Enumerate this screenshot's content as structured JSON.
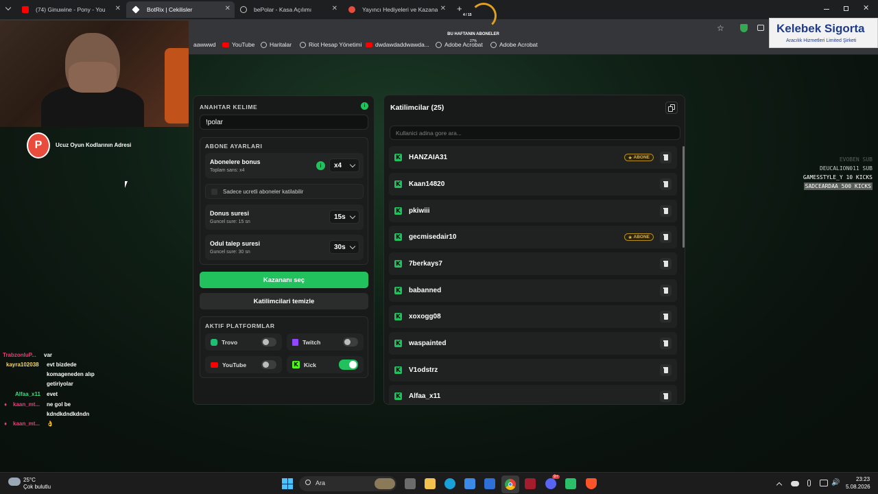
{
  "browser": {
    "tabs": [
      {
        "label": "(74) Ginuwine - Pony - You",
        "favicon_color": "#ff0000"
      },
      {
        "label": "BotRix | Cekilisler",
        "favicon_color": "#ffffff"
      },
      {
        "label": "bePolar - Kasa Açılımı",
        "favicon_color": "#e8eaed"
      },
      {
        "label": "Yayıncı Hediyeleri ve Kazananlar",
        "favicon_color": "#e84c3d"
      }
    ],
    "new_tab": "+",
    "bookmarks": [
      "aawwwd",
      "YouTube",
      "Haritalar",
      "Riot Hesap Yönetimi",
      "dwdawdaddwawda...",
      "Adobe Acrobat",
      "Adobe Acrobat"
    ]
  },
  "overlay": {
    "sub_goal_title": "BU HAFTANIN ABONELER",
    "sub_goal_percent": "27%",
    "sub_goal_count": "4 / 15",
    "sponsor_name": "Kelebek Sigorta",
    "sponsor_sub": "Aracılık Hizmetleri Limited Şirketi",
    "promo_text": "Ucuz Oyun Kodlarının Adresi",
    "events": [
      "EVOBEN SUB",
      "DEUCALION011 SUB",
      "GAMESSTYLE_Y 10 KICKS",
      "SADCEARDAA 500 KICKS"
    ]
  },
  "settings": {
    "keyword_label": "ANAHTAR KELIME",
    "keyword_value": "!polar",
    "sub_section_label": "ABONE AYARLARI",
    "bonus_title": "Abonelere bonus",
    "bonus_sub": "Toplam sans: x4",
    "bonus_value": "x4",
    "only_paid_label": "Sadece ucretli aboneler katilabilir",
    "duration_title": "Donus suresi",
    "duration_sub": "Guncel sure: 15 sn",
    "duration_value": "15s",
    "claim_title": "Odul talep suresi",
    "claim_sub": "Guncel sure: 30 sn",
    "claim_value": "30s",
    "pick_winner": "Kazananı seç",
    "clear_participants": "Katilimcilari temizle",
    "platforms_label": "AKTIF PLATFORMLAR",
    "platforms": [
      {
        "name": "Trovo",
        "enabled": false,
        "color": "#1dbf73"
      },
      {
        "name": "Twitch",
        "enabled": false,
        "color": "#9146ff"
      },
      {
        "name": "YouTube",
        "enabled": false,
        "color": "#ff0000"
      },
      {
        "name": "Kick",
        "enabled": true,
        "color": "#53fc18"
      }
    ]
  },
  "participants": {
    "title": "Katilimcilar (25)",
    "search_placeholder": "Kullanici adina gore ara...",
    "abone_badge": "ABONE",
    "list": [
      {
        "name": "HANZAIA31",
        "sub": true
      },
      {
        "name": "Kaan14820",
        "sub": false
      },
      {
        "name": "pkiwiii",
        "sub": false
      },
      {
        "name": "gecmisedair10",
        "sub": true
      },
      {
        "name": "7berkays7",
        "sub": false
      },
      {
        "name": "babanned",
        "sub": false
      },
      {
        "name": "xoxogg08",
        "sub": false
      },
      {
        "name": "waspainted",
        "sub": false
      },
      {
        "name": "V1odstrz",
        "sub": false
      },
      {
        "name": "Alfaa_x11",
        "sub": false
      }
    ]
  },
  "chat": [
    {
      "user": "TrabzonluP...",
      "msg": "var",
      "color": "#e0457b"
    },
    {
      "user": "kayra102038",
      "msg": "evt bizdede",
      "color": "#f5d76e"
    },
    {
      "user": "",
      "msg": "komageneden alıp",
      "color": ""
    },
    {
      "user": "",
      "msg": "getiriyolar",
      "color": ""
    },
    {
      "user": "Alfaa_x11",
      "msg": "evet",
      "color": "#3ddc84"
    },
    {
      "user": "kaan_mt...",
      "msg": "ne gol be",
      "color": "#e0457b"
    },
    {
      "user": "",
      "msg": "kdndkdndkdndn",
      "color": ""
    },
    {
      "user": "kaan_mt...",
      "msg": "👌",
      "color": "#e0457b"
    }
  ],
  "taskbar": {
    "temperature": "25°C",
    "weather": "Çok bulutlu",
    "search": "Ara",
    "time": "23:23",
    "date": "5.08.2026",
    "discord_badge": "9+"
  }
}
